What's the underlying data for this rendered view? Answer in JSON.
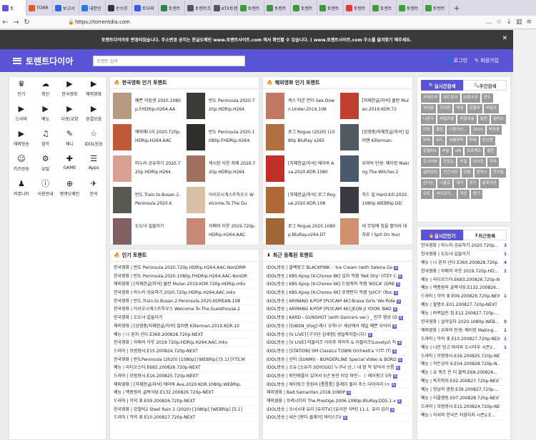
{
  "browser": {
    "tabs": [
      {
        "label": "토",
        "color": "#6b4fd8",
        "active": true
      },
      {
        "label": "TORR",
        "color": "#e05a2a"
      },
      {
        "label": "보고서",
        "color": "#2a6ae0"
      },
      {
        "label": "대한민",
        "color": "#2a7ae0"
      },
      {
        "label": "순수한",
        "color": "#333333"
      },
      {
        "label": "토다와",
        "color": "#3a5ae0"
      },
      {
        "label": "토렌트",
        "color": "#2a8a3a"
      },
      {
        "label": "토렌트조조",
        "color": "#555555"
      },
      {
        "label": "KTX토렌트",
        "color": "#555555"
      },
      {
        "label": "토렌트",
        "color": "#3a9a3a"
      },
      {
        "label": "토렌트",
        "color": "#3a9a3a"
      },
      {
        "label": "토렌트",
        "color": "#3a9a3a"
      },
      {
        "label": "토렌트",
        "color": "#3a9a3a"
      },
      {
        "label": "토렌트",
        "color": "#e03a3a"
      },
      {
        "label": "토렌트",
        "color": "#3aa03a"
      },
      {
        "label": "토렌트",
        "color": "#3aa03a"
      },
      {
        "label": "토렌트",
        "color": "#3aa03a"
      }
    ],
    "url": "https://torrentdia.com"
  },
  "notice": "토렌트다이아로 변경되었습니다. 주소변경 공지는 한글도메인 www.토렌트사이트.com 에서 확인할 수 있습니다. ( www.토렌트사이트.com 주소를 즐겨찾기 해주세요.",
  "header": {
    "logo": "토렌트다이아",
    "search_placeholder": "토렌트 검색",
    "login": "로그인",
    "signup": "회원가입"
  },
  "categories": [
    {
      "label": "인기",
      "icon": "♛"
    },
    {
      "label": "최신",
      "icon": "☁"
    },
    {
      "label": "한국영화",
      "icon": "▶"
    },
    {
      "label": "해외영화",
      "icon": "▶"
    },
    {
      "label": "드라마",
      "icon": "▶"
    },
    {
      "label": "예능",
      "icon": "▶"
    },
    {
      "label": "다큐/교양",
      "icon": "▶"
    },
    {
      "label": "완결모음",
      "icon": "▶"
    },
    {
      "label": "해외방송",
      "icon": "▶"
    },
    {
      "label": "음악",
      "icon": "♫"
    },
    {
      "label": "애니",
      "icon": "✎"
    },
    {
      "label": "IDOL방송",
      "icon": "☆"
    },
    {
      "label": "키즈방송",
      "icon": "☺"
    },
    {
      "label": "유틸",
      "icon": "⚙"
    },
    {
      "label": "GAME",
      "icon": "✚"
    },
    {
      "label": "Apps",
      "icon": "☰"
    },
    {
      "label": "커뮤니티",
      "icon": "♟"
    },
    {
      "label": "이용안내",
      "icon": "ⓘ"
    },
    {
      "label": "평생도메인",
      "icon": "⊕"
    },
    {
      "label": "문의",
      "icon": "✈"
    }
  ],
  "kr_movies": {
    "title": "한국영화 인기 토렌트",
    "items": [
      {
        "text": "예쁜 이듬생 2020.1080p.FHDRip.H264.AA",
        "color": "#b89a80"
      },
      {
        "text": "반도 Peninsula.2020.720p.HDRip.H264.",
        "color": "#3a3a36"
      },
      {
        "text": "에비메니리 2020.720p.HDRip.H264.AAC",
        "color": "#c05a3a"
      },
      {
        "text": "반도 Peninsula.2020.1080p.FHDRip.H264.",
        "color": "#2e2e2a"
      },
      {
        "text": "마누라 공유하기 2020.720p.HDRip.H264.",
        "color": "#d8a090"
      },
      {
        "text": "섹시한 이웃 자매 2020.720p.HDRip.H264.",
        "color": "#a07060"
      },
      {
        "text": "반도.Train.to.Busan.2.Peninsula.2020.K",
        "color": "#5a5a50"
      },
      {
        "text": "어서오시게스트하우스 Welcome.To.The.Gu",
        "color": "#d8c0a8"
      },
      {
        "text": "도도녀 길들이기",
        "color": "#806060"
      },
      {
        "text": "자매의 이웃 2019.720p.HDRip.H264.AAC",
        "color": "#c88878"
      }
    ]
  },
  "intl_movies": {
    "title": "해외영화 인기 토렌트",
    "items": [
      {
        "text": "섹스 티운 언더 Sex.Down.Under.2019.108",
        "color": "#c07860"
      },
      {
        "text": "[자체한글/자석] 뮬란 Mulan.2019.KOR.72",
        "color": "#c04030"
      },
      {
        "text": "로그 Rogue (2020) (1080p BluRay x265",
        "color": "#b07040"
      },
      {
        "text": "[상영중/자체한글/자석] 킬러맨 Killerman.",
        "color": "#505a60"
      },
      {
        "text": "[자체한글/자석] 에이바 Ava.2020.KOR.1080",
        "color": "#c03028"
      },
      {
        "text": "위쳐의 탄생: 메이킹 Making.The.Witcher.2",
        "color": "#4a5a6a"
      },
      {
        "text": "[자체한글/자석] 로그 Rogue.2020.KOR.108",
        "color": "#b06838"
      },
      {
        "text": "하드 킬 Hard.Kill.2020.1080p.WEBRip.DD",
        "color": "#3a3a44"
      },
      {
        "text": "로그 Rogue.2020.1080p.BluRay.x264.DT",
        "color": "#a06838"
      },
      {
        "text": "네 무덤에 침을 뱉어라 데자뷰 I Spit On Your",
        "color": "#d09070"
      }
    ]
  },
  "popular": {
    "title": "인기 토렌트",
    "rows": [
      "한국영화 | 반도 Peninsula.2020.720p.HDRip.H264.AAC-NonDRM",
      "한국영화 | 반도 Peninsula.2020.1080p.FHDRip.H264.AAC-NonDR",
      "해외영화 | [자체한글/자석] 뮬란 Mulan.2019.KOR.720p.HDRip.mkv",
      "한국영화 | 마누라 공유하기 2020.720p.HDRip.H264.AAC.mkv",
      "한국영화 | 반도.Train.to.Busan.2.Peninsula.2020.KOREAN.108",
      "한국영화 | 어서오시게스트하우스 Welcome.To.The.Guesthouse.2",
      "한국영화 | 도도녀 길들이기",
      "해외영화 | [상영중/자체한글/자석] 킬러맨 Killerman.2019.KOR.10",
      "예능 | 나 혼자 산다.E360.200828.720p-NEXT",
      "한국영화 | 자매의 이웃 2019.720p.HDRip.H264.AAC.mkv",
      "드라마 | 모범형사.E15.200824.720p-NEXT",
      "한국영화 | 반도Peninsula (2020) [1080p] [WEBRip] [5.1] [YTS.M",
      "예능 | 라디오스타.E683.200826.720p-NEXT",
      "드라마 | 모범형사.E16.200825.720p-NEXT'",
      "해외영화 | [자체한글/자석] 에이바 Ava.2020.KOR.1080p.WEBRip.",
      "예능 | 백종원의 골목식당.E132.200826.720p-NEXT",
      "드라마 | 악의 꽃.E09.200826.720p-NEXT",
      "한국영화 | 강철비2 Steel Rain 2 (2020) [1080p] [WEBRip] [5.1]",
      "드라마 | 악의 꽃.E10.200827.720p-NEXT"
    ]
  },
  "recent": {
    "title": "최근 등록된 토렌트",
    "rows": [
      "IDOL방송 | 블랙핑크 BLACKPINK - 'Ice Cream (with Selena Go",
      "IDOL방송 | KBS Kpop [K-Choreo 8K] 있지 직캠 'Not Shy' (ITZY C",
      "IDOL방송 | KBS Kpop [K-Choreo 6K] 드림캐쳐 직캠 'BOCA' (DRE",
      "IDOL방송 | KBS Kpop [K-Choreo 6K] 로켓펀치 직캠 'JUICY' (Roc",
      "IDOL방송 | ARIRANG K-POP [PLYCAM 4K] Brave Girls 'We Ride",
      "IDOL방송 | ARIRANG K-POP [PLYCAM 4K] JEON JI YOON 'BAD",
      "IDOL방송 | KARD - GUNSHOT (with Dancers ver.) _ 인무 영상 (D",
      "IDOL방송 | [GWSN_Vlog] 레나 오하나? 세상에서 제일 예쁜 오아이",
      "IDOL방송 | [V LIVE] [구구단 김세정] 생일축하합니다!",
      "IDOL방송 | [V LIVE] 러블리즈 이미주 하하히 & 러블리즈(Lovelyz) 직",
      "IDOL방송 | [STATION] SM Classics TOWN Orchestra '너무 (Ti",
      "IDOL방송 | 선미 (SUNMI) - BORDERLINE Special Video & BORD",
      "IDOL방송 | 소유 [소유가 SOYOUG] 누구냐 넌..! 내 맞 막 맞어서 쓰름",
      "IDOL방송 | 파인애플이 있어서 5년 동안 이잉 파인~ ㅣ 에이핑크 5하",
      "IDOL방송 | 에이핑크 응원러 [통통통] 플레이 볼리 주스 다이어리 (+",
      "해외영화 | Bad.Samaritan.2018.1080P",
      "해외영화 | 프레시티지 The.Prestige.2006.1080p.BluRay.DD5.1.x",
      "IDOL방송 | 소녀시대 유리 [유리TV] [유리한 식탁] 11-1. 유리 김리",
      "IDOL방송 | 테슨 [판타 클레이] 바이스TV"
    ]
  },
  "right": {
    "tab_search": "실시간검색",
    "tab_weekly": "주간검색",
    "tags": [
      "국제수사",
      "위드유어",
      "브람스의",
      "반도",
      "악의꽃",
      "우아한",
      "테넷",
      "강철비",
      "비밀의",
      "나혼자",
      "비밀의숲",
      "비밀의숲",
      "놀면",
      "엘리스",
      "티빙",
      "블란",
      "나혼자산...",
      "2020",
      "악의꽃",
      "마피",
      "위드",
      "여름방학",
      "파워",
      "런닝맨",
      "강철비2",
      "비숲",
      "sf8",
      "프로젝트",
      "뮬란",
      "도시어부",
      "맛있는",
      "비밀",
      "이삭강",
      "우리",
      "살아있다",
      "인간극장",
      "모범",
      "원미스",
      "친구들",
      "신나는",
      "나홀로",
      "대가",
      "정구",
      "골목식당",
      "오토",
      "사이코지...",
      "라인",
      "랩기"
    ],
    "tab_popular": "실시간인기",
    "tab_recent": "최근등록",
    "rows": [
      {
        "text": "한국영화 | 마누라 공유하기 2020.720p...",
        "num": "3"
      },
      {
        "text": "한국영화 | 도도녀 길들이기",
        "num": "1"
      },
      {
        "text": "예능 | 나 혼자 산다.E360.200828.720p...",
        "num": "4"
      },
      {
        "text": "한국영화 | 자매의 이웃 2019.720p.HD...",
        "num": "1"
      },
      {
        "text": "예능 | 라디오스타.E683.200826.720p-NEXT",
        "num": ""
      },
      {
        "text": "예능 | 백종원의 골목식당.E132.200826...",
        "num": ""
      },
      {
        "text": "드라마 | 악의 꽃.E09.200826.720p-NEXT",
        "num": "1"
      },
      {
        "text": "예능 | 할명수.E01.200827.720p-NEXT",
        "num": ""
      },
      {
        "text": "예능 | 바퀴달린 집.E12.200827.720p-...",
        "num": ""
      },
      {
        "text": "한국영화 | 살아있다 2020.1080p.WEB...",
        "num": "5"
      },
      {
        "text": "해외영화 | 위쳐의 탄생: 메이킹 Making...",
        "num": "1"
      },
      {
        "text": "드라마 | 악의 꽃.E10.200827.720p-NEXT",
        "num": "1"
      },
      {
        "text": "예능 | 나만 믿고 따라와 도시어부 시즌2...",
        "num": "1"
      },
      {
        "text": "드라마 | 모범형사.E16.200825.720p-NEXT",
        "num": ""
      },
      {
        "text": "예능 | 히든싱어 6.E04.200828.720p-N...",
        "num": ""
      },
      {
        "text": "예능 | 유 퀴즈 온 더 블럭.E69.200826...",
        "num": ""
      },
      {
        "text": "예능 | 독치학지.E02.200827.720p-NEXT",
        "num": ""
      },
      {
        "text": "예능 | 맛남의 광장.E39.200827.720p-...",
        "num": ""
      },
      {
        "text": "예능 | 이플렛핑.E07.200828.720p-NEXT",
        "num": ""
      },
      {
        "text": "드라마 | 모범형사.E15.200824.720p-NEXT",
        "num": ""
      },
      {
        "text": "예능 | 어서와 한국은 처음이지 시즌2.E...",
        "num": ""
      }
    ]
  }
}
